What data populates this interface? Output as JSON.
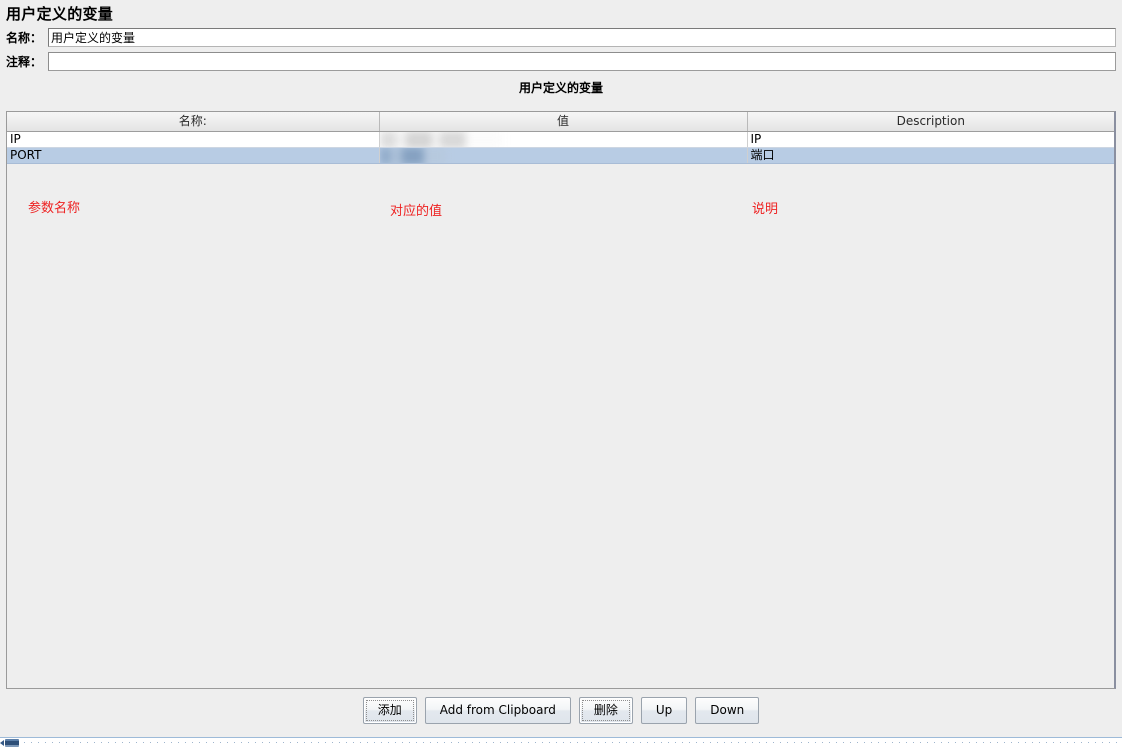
{
  "panel": {
    "title": "用户定义的变量"
  },
  "form": {
    "name_label": "名称：",
    "name_value": "用户定义的变量",
    "comment_label": "注释：",
    "comment_value": ""
  },
  "table": {
    "section_title": "用户定义的变量",
    "columns": [
      "名称:",
      "值",
      "Description"
    ],
    "rows": [
      {
        "name": "IP",
        "value": "",
        "value_redacted": true,
        "description": "IP",
        "selected": false
      },
      {
        "name": "PORT",
        "value": "",
        "value_redacted": true,
        "description": "端口",
        "selected": true
      }
    ]
  },
  "annotations": {
    "name": "参数名称",
    "value": "对应的值",
    "description": "说明",
    "color": "#ee2222"
  },
  "buttons": [
    {
      "label": "添加",
      "focused": true
    },
    {
      "label": "Add from Clipboard",
      "focused": false
    },
    {
      "label": "删除",
      "focused": true
    },
    {
      "label": "Up",
      "focused": false
    },
    {
      "label": "Down",
      "focused": false
    }
  ],
  "colors": {
    "background": "#eeeeee",
    "selection": "#b8cce4",
    "field_border": "#7a7a7a"
  }
}
